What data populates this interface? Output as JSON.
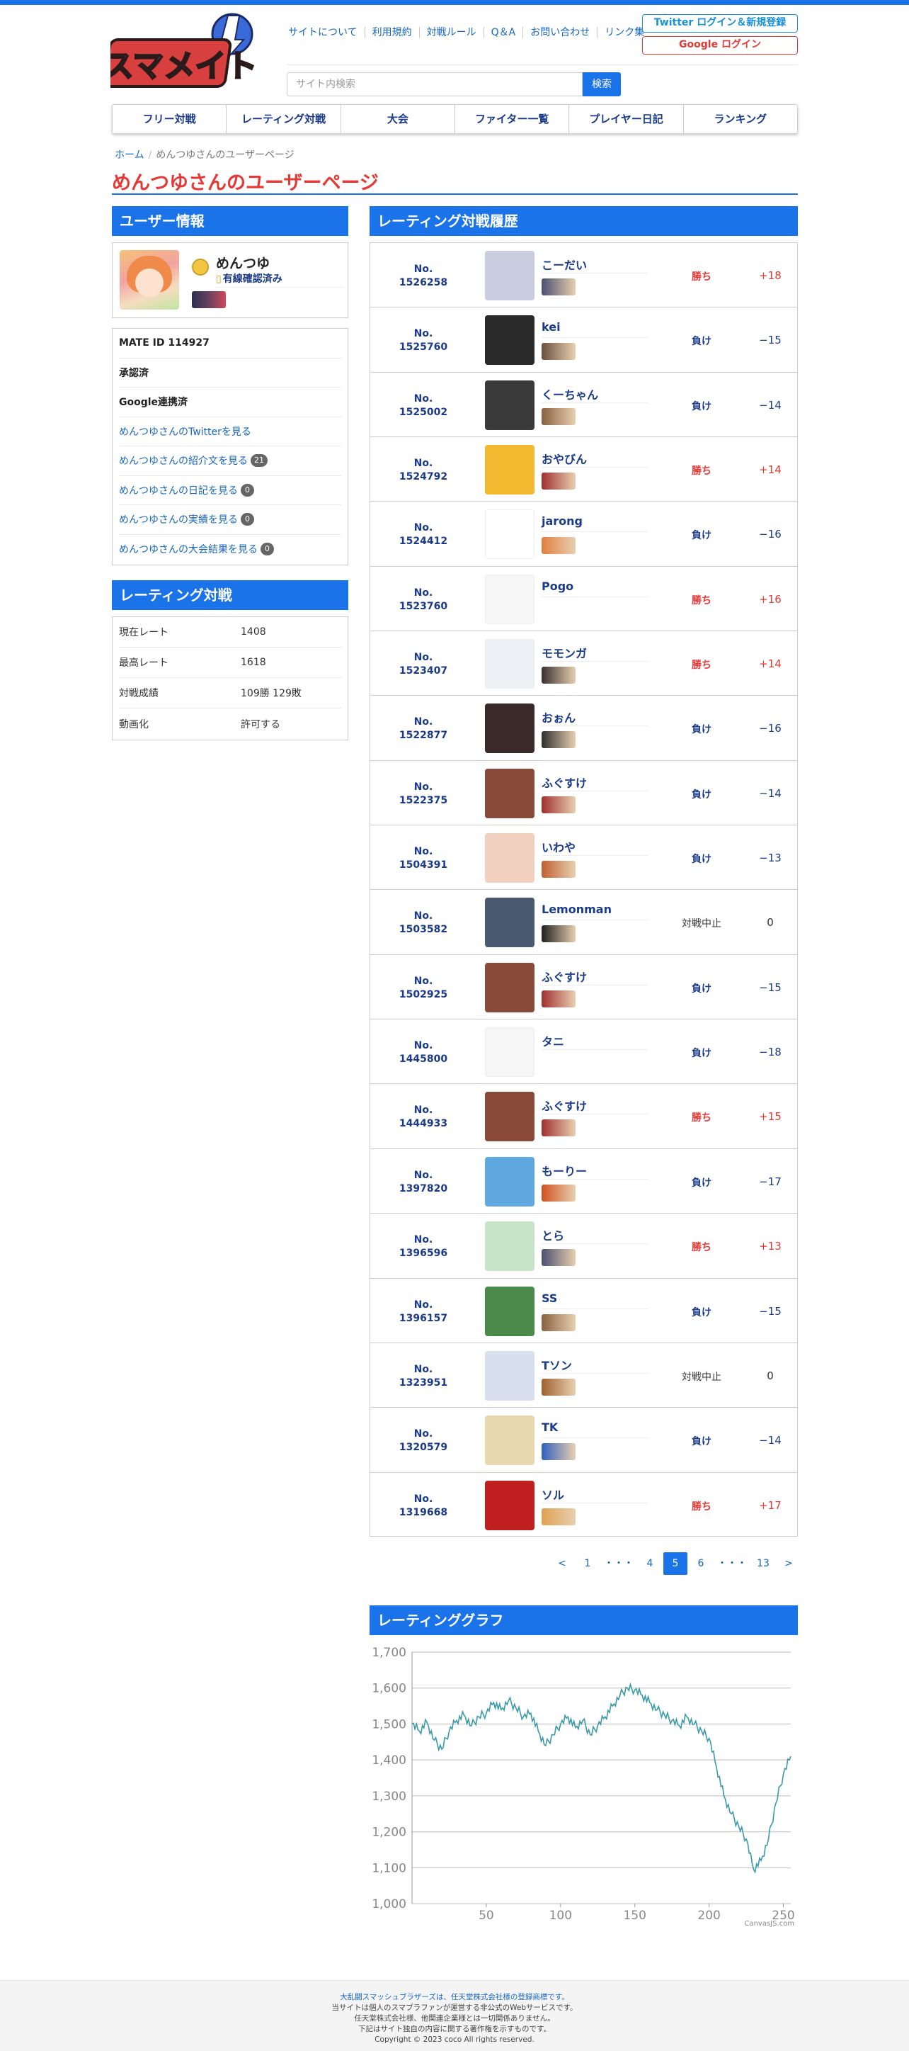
{
  "site": {
    "logo_text": "スマメイト",
    "top_links": [
      "サイトについて",
      "利用規約",
      "対戦ルール",
      "Q＆A",
      "お問い合わせ",
      "リンク集"
    ],
    "twitter_login": "Twitter ログイン＆新規登録",
    "google_login": "Google ログイン",
    "search_placeholder": "サイト内検索",
    "search_button": "検索",
    "main_nav": [
      "フリー対戦",
      "レーティング対戦",
      "大会",
      "ファイター一覧",
      "プレイヤー日記",
      "ランキング"
    ]
  },
  "breadcrumb": {
    "home": "ホーム",
    "sep": "/",
    "current": "めんつゆさんのユーザーページ"
  },
  "page_title": "めんつゆさんのユーザーページ",
  "user_info": {
    "header": "ユーザー情報",
    "name": "めんつゆ",
    "verified_icon": "shield-icon",
    "verified": "有線確認済み",
    "details": [
      {
        "text": "MATE ID 114927",
        "style": "bold"
      },
      {
        "text": "承認済",
        "style": "bold"
      },
      {
        "text": "Google連携済",
        "style": "bold"
      },
      {
        "text": "めんつゆさんのTwitterを見る",
        "style": "link"
      },
      {
        "text": "めんつゆさんの紹介文を見る",
        "style": "link",
        "badge": "21"
      },
      {
        "text": "めんつゆさんの日記を見る",
        "style": "link",
        "badge": "0"
      },
      {
        "text": "めんつゆさんの実績を見る",
        "style": "link",
        "badge": "0"
      },
      {
        "text": "めんつゆさんの大会結果を見る",
        "style": "link",
        "badge": "0"
      }
    ]
  },
  "rating": {
    "header": "レーティング対戦",
    "rows": [
      {
        "label": "現在レート",
        "value": "1408"
      },
      {
        "label": "最高レート",
        "value": "1618"
      },
      {
        "label": "対戦成績",
        "value": "109勝 129敗"
      },
      {
        "label": "動画化",
        "value": "許可する"
      }
    ]
  },
  "history": {
    "header": "レーティング対戦履歴",
    "no_prefix": "No.",
    "rows": [
      {
        "no": "1526258",
        "opponent": "こーだい",
        "result": "勝ち",
        "outcome": "win",
        "delta": "+18",
        "thumb": "#c8cde0",
        "fighter": "#4a5070"
      },
      {
        "no": "1525760",
        "opponent": "kei",
        "result": "負け",
        "outcome": "lose",
        "delta": "−15",
        "thumb": "#2a2a2a",
        "fighter": "#6a5040"
      },
      {
        "no": "1525002",
        "opponent": "くーちゃん",
        "result": "負け",
        "outcome": "lose",
        "delta": "−14",
        "thumb": "#3a3a3a",
        "fighter": "#8a6040"
      },
      {
        "no": "1524792",
        "opponent": "おやびん",
        "result": "勝ち",
        "outcome": "win",
        "delta": "+14",
        "thumb": "#f2b830",
        "fighter": "#a03030"
      },
      {
        "no": "1524412",
        "opponent": "jarong",
        "result": "負け",
        "outcome": "lose",
        "delta": "−16",
        "thumb": "#ffffff",
        "fighter": "#e08040"
      },
      {
        "no": "1523760",
        "opponent": "Pogo",
        "result": "勝ち",
        "outcome": "win",
        "delta": "+16",
        "thumb": "#f6f6f6",
        "fighter": ""
      },
      {
        "no": "1523407",
        "opponent": "モモンガ",
        "result": "勝ち",
        "outcome": "win",
        "delta": "+14",
        "thumb": "#eef0f6",
        "fighter": "#3a3030"
      },
      {
        "no": "1522877",
        "opponent": "おぉん",
        "result": "負け",
        "outcome": "lose",
        "delta": "−16",
        "thumb": "#3a2a2a",
        "fighter": "#303030"
      },
      {
        "no": "1522375",
        "opponent": "ふぐすけ",
        "result": "負け",
        "outcome": "lose",
        "delta": "−14",
        "thumb": "#8a4a3a",
        "fighter": "#a03030"
      },
      {
        "no": "1504391",
        "opponent": "いわや",
        "result": "負け",
        "outcome": "lose",
        "delta": "−13",
        "thumb": "#f2d0c0",
        "fighter": "#c06030"
      },
      {
        "no": "1503582",
        "opponent": "Lemonman",
        "result": "対戦中止",
        "outcome": "draw",
        "delta": "0",
        "thumb": "#4a5a70",
        "fighter": "#202020"
      },
      {
        "no": "1502925",
        "opponent": "ふぐすけ",
        "result": "負け",
        "outcome": "lose",
        "delta": "−15",
        "thumb": "#8a4a3a",
        "fighter": "#a03030"
      },
      {
        "no": "1445800",
        "opponent": "タニ",
        "result": "負け",
        "outcome": "lose",
        "delta": "−18",
        "thumb": "#f6f6f6",
        "fighter": ""
      },
      {
        "no": "1444933",
        "opponent": "ふぐすけ",
        "result": "勝ち",
        "outcome": "win",
        "delta": "+15",
        "thumb": "#8a4a3a",
        "fighter": "#a03030"
      },
      {
        "no": "1397820",
        "opponent": "もーりー",
        "result": "負け",
        "outcome": "lose",
        "delta": "−17",
        "thumb": "#60a8e0",
        "fighter": "#d05020"
      },
      {
        "no": "1396596",
        "opponent": "とら",
        "result": "勝ち",
        "outcome": "win",
        "delta": "+13",
        "thumb": "#c8e4c8",
        "fighter": "#4a5070"
      },
      {
        "no": "1396157",
        "opponent": "SS",
        "result": "負け",
        "outcome": "lose",
        "delta": "−15",
        "thumb": "#4a8a4a",
        "fighter": "#8a6040"
      },
      {
        "no": "1323951",
        "opponent": "Tソン",
        "result": "対戦中止",
        "outcome": "draw",
        "delta": "0",
        "thumb": "#d8e0f0",
        "fighter": "#a06030"
      },
      {
        "no": "1320579",
        "opponent": "TK",
        "result": "負け",
        "outcome": "lose",
        "delta": "−14",
        "thumb": "#e8d8b0",
        "fighter": "#3060c0"
      },
      {
        "no": "1319668",
        "opponent": "ソル",
        "result": "勝ち",
        "outcome": "win",
        "delta": "+17",
        "thumb": "#c02020",
        "fighter": "#e0a050"
      }
    ]
  },
  "pagination": [
    {
      "label": "<",
      "active": false,
      "wide": false
    },
    {
      "label": "1",
      "active": false,
      "wide": false
    },
    {
      "label": "・・・",
      "active": false,
      "wide": true
    },
    {
      "label": "4",
      "active": false,
      "wide": false
    },
    {
      "label": "5",
      "active": true,
      "wide": false
    },
    {
      "label": "6",
      "active": false,
      "wide": false
    },
    {
      "label": "・・・",
      "active": false,
      "wide": true
    },
    {
      "label": "13",
      "active": false,
      "wide": false
    },
    {
      "label": ">",
      "active": false,
      "wide": false
    }
  ],
  "graph": {
    "header": "レーティンググラフ",
    "credit": "CanvasJS.com"
  },
  "chart_data": {
    "type": "line",
    "title": "",
    "xlabel": "",
    "ylabel": "",
    "xlim": [
      0,
      255
    ],
    "ylim": [
      1000,
      1700
    ],
    "x_ticks": [
      50,
      100,
      150,
      200,
      250
    ],
    "y_ticks": [
      1000,
      1100,
      1200,
      1300,
      1400,
      1500,
      1600,
      1700
    ],
    "y_tick_labels": [
      "1,000",
      "1,100",
      "1,200",
      "1,300",
      "1,400",
      "1,500",
      "1,600",
      "1,700"
    ],
    "grid": true,
    "line_color": "#3a9aa6",
    "series": [
      {
        "name": "",
        "points": [
          [
            0,
            1500
          ],
          [
            5,
            1480
          ],
          [
            10,
            1505
          ],
          [
            15,
            1455
          ],
          [
            20,
            1430
          ],
          [
            25,
            1480
          ],
          [
            30,
            1510
          ],
          [
            35,
            1525
          ],
          [
            40,
            1495
          ],
          [
            45,
            1520
          ],
          [
            50,
            1530
          ],
          [
            55,
            1560
          ],
          [
            60,
            1540
          ],
          [
            65,
            1565
          ],
          [
            70,
            1545
          ],
          [
            75,
            1520
          ],
          [
            80,
            1530
          ],
          [
            85,
            1480
          ],
          [
            90,
            1440
          ],
          [
            95,
            1470
          ],
          [
            100,
            1500
          ],
          [
            105,
            1520
          ],
          [
            110,
            1490
          ],
          [
            115,
            1510
          ],
          [
            120,
            1470
          ],
          [
            125,
            1495
          ],
          [
            130,
            1520
          ],
          [
            135,
            1550
          ],
          [
            140,
            1580
          ],
          [
            145,
            1600
          ],
          [
            150,
            1595
          ],
          [
            155,
            1580
          ],
          [
            160,
            1560
          ],
          [
            165,
            1540
          ],
          [
            170,
            1525
          ],
          [
            175,
            1510
          ],
          [
            180,
            1495
          ],
          [
            185,
            1520
          ],
          [
            190,
            1500
          ],
          [
            195,
            1480
          ],
          [
            200,
            1460
          ],
          [
            205,
            1380
          ],
          [
            210,
            1300
          ],
          [
            215,
            1250
          ],
          [
            220,
            1215
          ],
          [
            225,
            1180
          ],
          [
            230,
            1095
          ],
          [
            235,
            1120
          ],
          [
            240,
            1180
          ],
          [
            245,
            1280
          ],
          [
            250,
            1360
          ],
          [
            255,
            1410
          ]
        ]
      }
    ]
  },
  "footer": {
    "lines": [
      {
        "text": "大乱闘スマッシュブラザーズは、任天堂株式会社様の登録商標です。",
        "link": true
      },
      {
        "text": "当サイトは個人のスマブラファンが運営する非公式のWebサービスです。",
        "link": false
      },
      {
        "text": "任天堂株式会社様、他関連企業様とは一切関係ありません。",
        "link": false
      },
      {
        "text": "下記はサイト独自の内容に関する著作権を示すものです。",
        "link": false
      },
      {
        "text": "Copyright © 2023 coco All rights reserved.",
        "link": false
      }
    ]
  }
}
